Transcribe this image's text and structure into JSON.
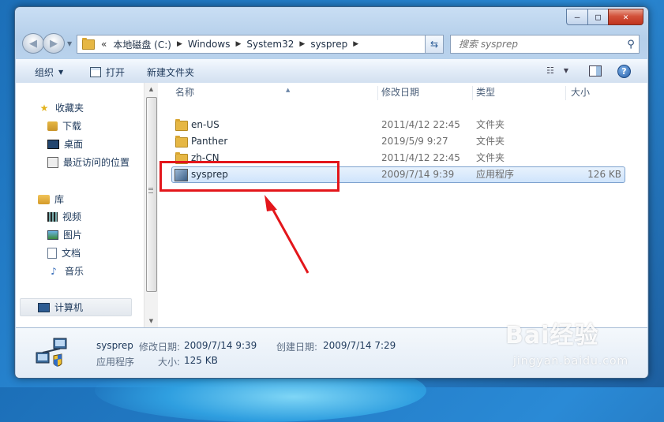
{
  "window": {
    "caption": {
      "minimize": "–",
      "maximize": "□",
      "close": "✕"
    }
  },
  "address_bar": {
    "overflow": "«",
    "crumbs": [
      "本地磁盘 (C:)",
      "Windows",
      "System32",
      "sysprep"
    ]
  },
  "search": {
    "placeholder": "搜索 sysprep"
  },
  "toolbar": {
    "organize": "组织",
    "open": "打开",
    "new_folder": "新建文件夹"
  },
  "sidebar": {
    "favorites": {
      "label": "收藏夹",
      "items": [
        "下载",
        "桌面",
        "最近访问的位置"
      ]
    },
    "libraries": {
      "label": "库",
      "items": [
        "视频",
        "图片",
        "文档",
        "音乐"
      ]
    },
    "computer": "计算机"
  },
  "file_list": {
    "columns": [
      "名称",
      "修改日期",
      "类型",
      "大小"
    ],
    "rows": [
      {
        "name": "en-US",
        "modified": "2011/4/12 22:45",
        "type": "文件夹",
        "size": ""
      },
      {
        "name": "Panther",
        "modified": "2019/5/9 9:27",
        "type": "文件夹",
        "size": ""
      },
      {
        "name": "zh-CN",
        "modified": "2011/4/12 22:45",
        "type": "文件夹",
        "size": ""
      },
      {
        "name": "sysprep",
        "modified": "2009/7/14 9:39",
        "type": "应用程序",
        "size": "126 KB"
      }
    ]
  },
  "details": {
    "name": "sysprep",
    "type": "应用程序",
    "modified_label": "修改日期:",
    "modified": "2009/7/14 9:39",
    "created_label": "创建日期:",
    "created": "2009/7/14 7:29",
    "size_label": "大小:",
    "size": "125 KB"
  },
  "watermark": {
    "brand": "Bai经验",
    "url": "jingyan.baidu.com"
  },
  "colors": {
    "annotation": "#e3161b",
    "selection": "#cfe4fb"
  }
}
